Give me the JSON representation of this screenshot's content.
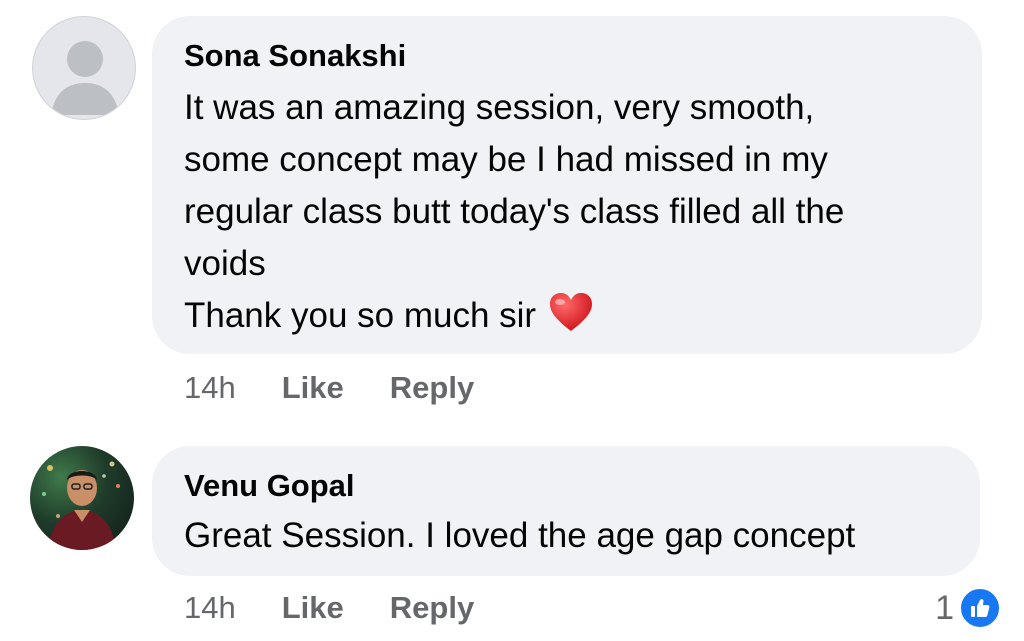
{
  "comments": [
    {
      "author": "Sona Sonakshi",
      "text": "It was an amazing session, very smooth,\nsome concept may be I had missed in my\nregular class butt today's class filled all the\nvoids\nThank you so much sir",
      "emoji": "red-heart",
      "time": "14h",
      "like_label": "Like",
      "reply_label": "Reply"
    },
    {
      "author": "Venu Gopal",
      "text": "Great Session. I loved the age gap concept",
      "time": "14h",
      "like_label": "Like",
      "reply_label": "Reply",
      "reaction_count": "1",
      "reaction_icon": "thumbs-up-icon"
    }
  ],
  "colors": {
    "bubble": "#f0f2f5",
    "meta_text": "#65676b",
    "like_blue": "#1877f2",
    "heart_red": "#e0242b"
  }
}
